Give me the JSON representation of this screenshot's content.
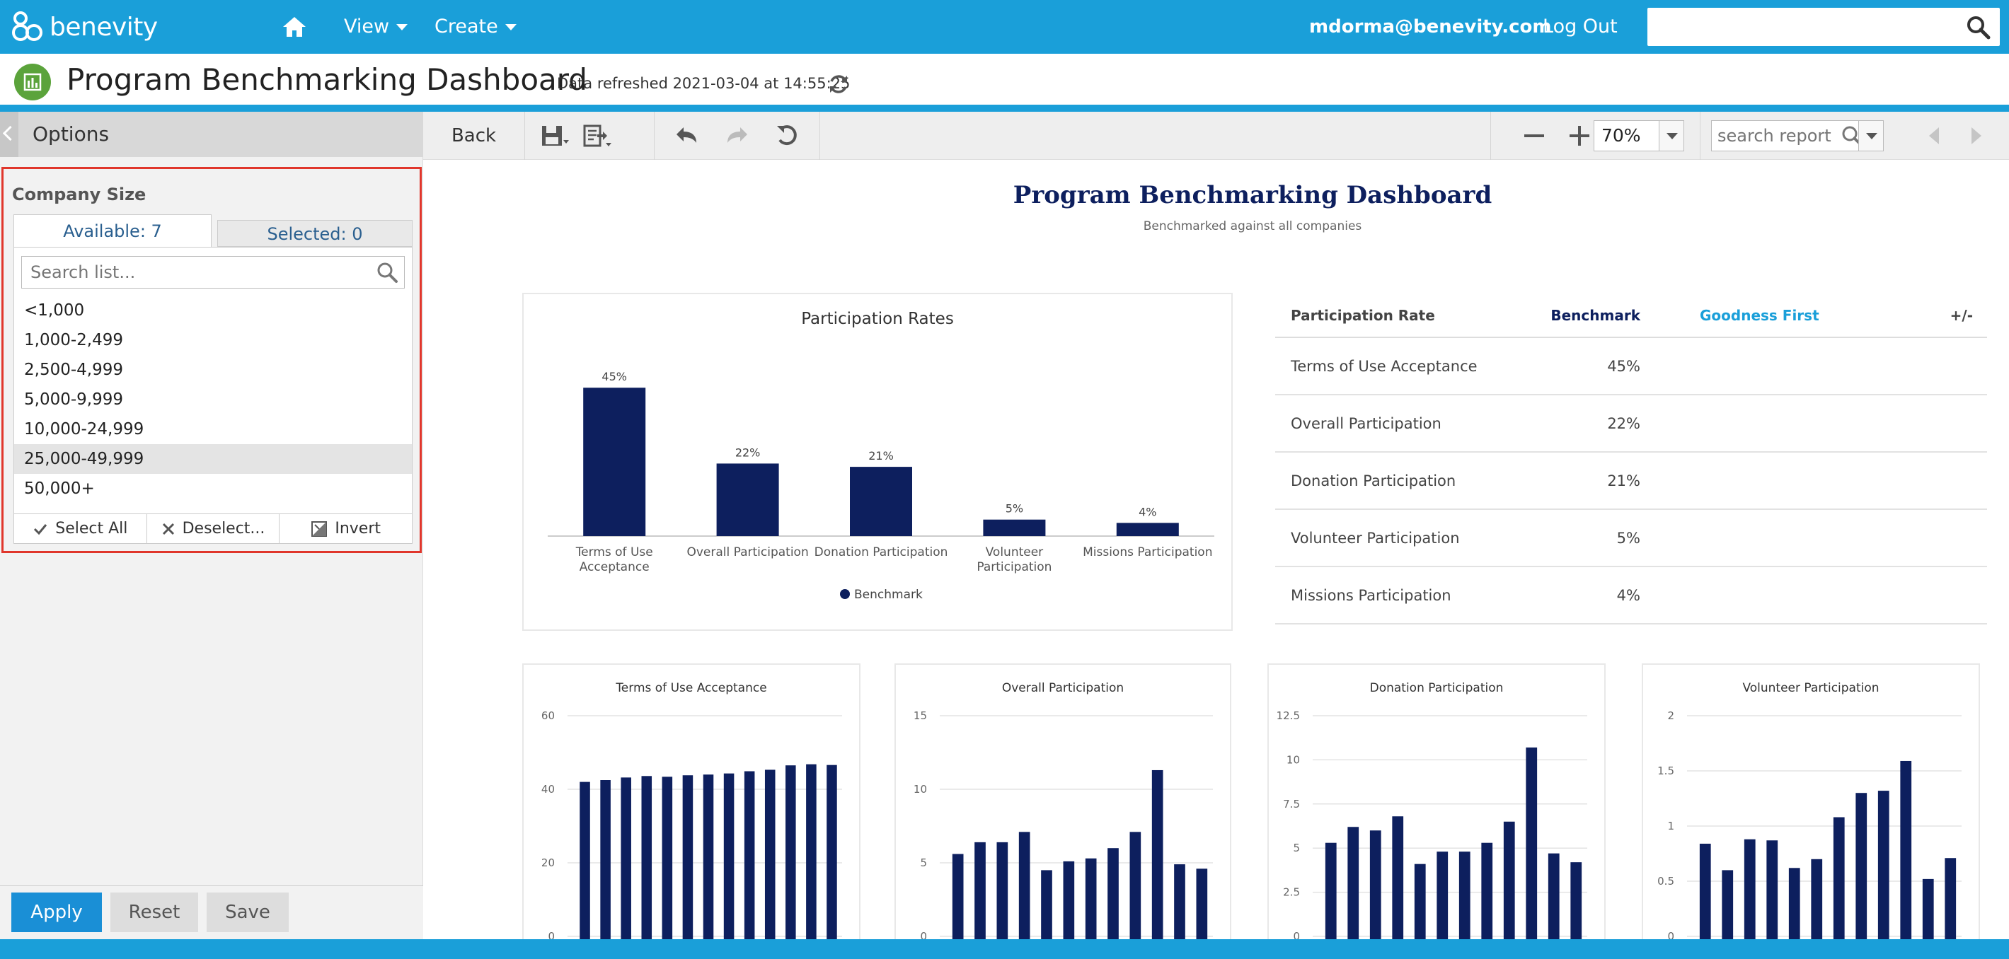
{
  "app": {
    "logo_text": "benevity",
    "user": "mdorma@benevity.com",
    "logout_label": "Log Out"
  },
  "nav": {
    "view_label": "View",
    "create_label": "Create"
  },
  "title": {
    "text": "Program Benchmarking Dashboard",
    "refresh": "Data refreshed 2021-03-04 at 14:55:25"
  },
  "options": {
    "header": "Options",
    "filter_label": "Company Size",
    "tab_available": "Available: 7",
    "tab_selected": "Selected: 0",
    "search_placeholder": "Search list...",
    "items": [
      "<1,000",
      "1,000-2,499",
      "2,500-4,999",
      "5,000-9,999",
      "10,000-24,999",
      "25,000-49,999",
      "50,000+"
    ],
    "select_all": "Select All",
    "deselect": "Deselect...",
    "invert": "Invert",
    "apply": "Apply",
    "reset": "Reset",
    "save": "Save"
  },
  "toolbar": {
    "back": "Back",
    "zoom": "70%",
    "search_placeholder": "search report"
  },
  "report": {
    "title": "Program Benchmarking Dashboard",
    "subtitle": "Benchmarked against all companies",
    "table": {
      "headers": [
        "Participation Rate",
        "Benchmark",
        "Goodness First",
        "+/-"
      ],
      "rows": [
        {
          "label": "Terms of Use Acceptance",
          "benchmark": "45%"
        },
        {
          "label": "Overall Participation",
          "benchmark": "22%"
        },
        {
          "label": "Donation Participation",
          "benchmark": "21%"
        },
        {
          "label": "Volunteer Participation",
          "benchmark": "5%"
        },
        {
          "label": "Missions Participation",
          "benchmark": "4%"
        }
      ]
    }
  },
  "colors": {
    "accent": "#1a9fd9",
    "bar": "#0d1f5e",
    "highlight_border": "#e0362c",
    "apply": "#1a8fd6",
    "goodness": "#1a9fd9"
  },
  "chart_data": [
    {
      "type": "bar",
      "title": "Participation Rates",
      "categories": [
        "Terms of Use Acceptance",
        "Overall Participation",
        "Donation Participation",
        "Volunteer Participation",
        "Missions Participation"
      ],
      "category_lines": [
        [
          "Terms of Use",
          "Acceptance"
        ],
        [
          "Overall Participation"
        ],
        [
          "Donation Participation"
        ],
        [
          "Volunteer",
          "Participation"
        ],
        [
          "Missions Participation"
        ]
      ],
      "series": [
        {
          "name": "Benchmark",
          "values": [
            45,
            22,
            21,
            5,
            4
          ]
        }
      ],
      "data_labels": [
        "45%",
        "22%",
        "21%",
        "5%",
        "4%"
      ],
      "ylim": [
        0,
        50
      ],
      "legend": "bottom"
    },
    {
      "type": "bar",
      "title": "Terms of Use Acceptance",
      "values": [
        42,
        42.5,
        43.2,
        43.6,
        43.4,
        43.8,
        44,
        44.3,
        44.9,
        45.3,
        46.5,
        46.8,
        46.6
      ],
      "ylim": [
        0,
        60
      ],
      "y_ticks": [
        "0",
        "20",
        "40",
        "60"
      ],
      "y_values": [
        0,
        20,
        40,
        60
      ]
    },
    {
      "type": "bar",
      "title": "Overall Participation",
      "values": [
        5.6,
        6.4,
        6.4,
        7.1,
        4.5,
        5.1,
        5.3,
        6,
        7.1,
        11.3,
        4.9,
        4.6
      ],
      "ylim": [
        0,
        15
      ],
      "y_ticks": [
        "0",
        "5",
        "10",
        "15"
      ],
      "y_values": [
        0,
        5,
        10,
        15
      ]
    },
    {
      "type": "bar",
      "title": "Donation Participation",
      "values": [
        5.3,
        6.2,
        6,
        6.8,
        4.1,
        4.8,
        4.8,
        5.3,
        6.5,
        10.7,
        4.7,
        4.2
      ],
      "ylim": [
        0,
        12.5
      ],
      "y_ticks": [
        "0",
        "2.5",
        "5",
        "7.5",
        "10",
        "12.5"
      ],
      "y_values": [
        0,
        2.5,
        5,
        7.5,
        10,
        12.5
      ]
    },
    {
      "type": "bar",
      "title": "Volunteer Participation",
      "values": [
        0.84,
        0.6,
        0.88,
        0.87,
        0.62,
        0.7,
        1.08,
        1.3,
        1.32,
        1.59,
        0.52,
        0.71
      ],
      "ylim": [
        0,
        2
      ],
      "y_ticks": [
        "0",
        "0.5",
        "1",
        "1.5",
        "2"
      ],
      "y_values": [
        0,
        0.5,
        1,
        1.5,
        2
      ]
    }
  ]
}
